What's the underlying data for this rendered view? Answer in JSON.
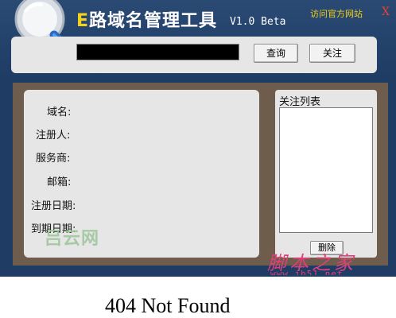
{
  "header": {
    "title_e": "E",
    "title_rest": "路域名管理工具",
    "version": "V1.0 Beta",
    "visit_link": "访问官方网站",
    "close_label": "X"
  },
  "search": {
    "input_value": "",
    "query_button": "查询",
    "follow_button": "关注"
  },
  "info": {
    "fields": [
      {
        "label": "域名:"
      },
      {
        "label": "注册人:"
      },
      {
        "label": "服务商:"
      },
      {
        "label": "邮箱:"
      },
      {
        "label": "注册日期:"
      },
      {
        "label": "到期日期:"
      }
    ]
  },
  "watchlist": {
    "title": "关注列表",
    "delete_button": "删除"
  },
  "watermarks": {
    "left": "吕云网",
    "right": "脚本之家",
    "url": "www.jb51.net"
  },
  "browser": {
    "error_text": "404 Not Found"
  },
  "colors": {
    "window_bg": "#1e3c64",
    "accent_yellow": "#f2d21a",
    "panel_bg": "#e6e6e6",
    "frame_bg": "#6e5c4c",
    "close_red": "#e84030"
  }
}
